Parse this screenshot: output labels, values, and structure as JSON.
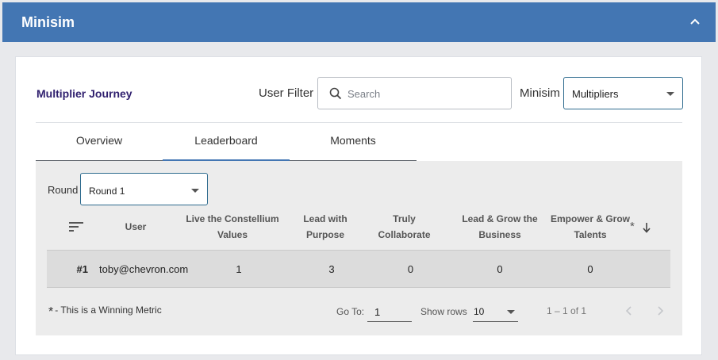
{
  "header": {
    "title": "Minisim",
    "collapse_icon": "chevron-up-icon"
  },
  "card": {
    "title": "Multiplier Journey",
    "user_filter_label": "User Filter",
    "search": {
      "value": "",
      "placeholder": "Search",
      "icon": "search-icon"
    },
    "minisim_label": "Minisim",
    "minisim_selected": "Multipliers"
  },
  "tabs": [
    {
      "label": "Overview",
      "active": false
    },
    {
      "label": "Leaderboard",
      "active": true
    },
    {
      "label": "Moments",
      "active": false
    }
  ],
  "leaderboard": {
    "round_label": "Round",
    "round_selected": "Round 1",
    "columns": {
      "user": "User",
      "metrics": [
        "Live the Constellium Values",
        "Lead with Purpose",
        "Truly Collaborate",
        "Lead & Grow the Business",
        "Empower & Grow Talents"
      ],
      "winning_marker": "*"
    },
    "rows": [
      {
        "rank": "#1",
        "user": "toby@chevron.com",
        "values": [
          "1",
          "3",
          "0",
          "0",
          "0"
        ]
      }
    ],
    "legend": {
      "star": "*",
      "text": "- This is a Winning Metric"
    },
    "pagination": {
      "goto_label": "Go To:",
      "goto_value": "1",
      "rows_label": "Show rows",
      "rows_selected": "10",
      "range": "1 – 1 of 1"
    }
  },
  "colors": {
    "header_bg": "#4376b3",
    "title_purple": "#2f1f6e",
    "select_border": "#2e6b8e",
    "panel_bg": "#ececec"
  }
}
